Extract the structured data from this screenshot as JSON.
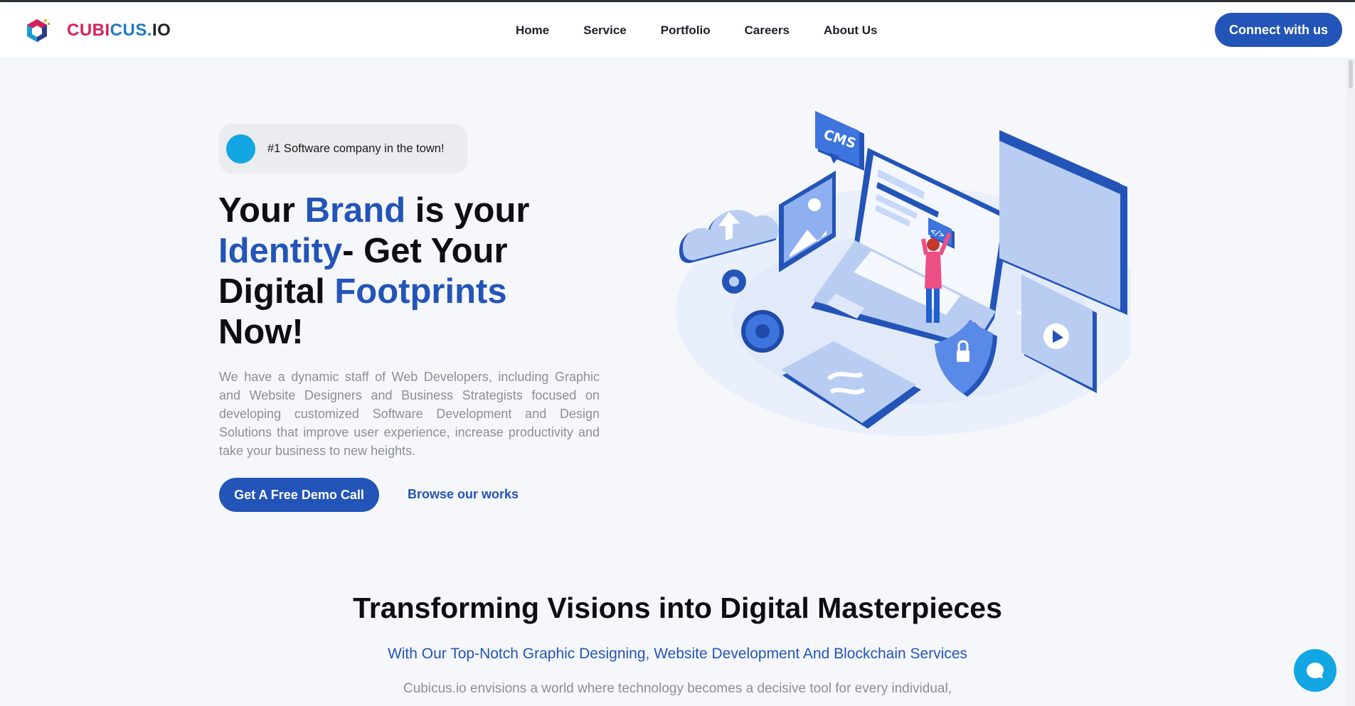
{
  "nav": {
    "logo": {
      "part1": "CUBI",
      "part2": "CUS.",
      "part3": "IO"
    },
    "links": [
      "Home",
      "Service",
      "Portfolio",
      "Careers",
      "About Us"
    ],
    "cta": "Connect with us"
  },
  "hero": {
    "badge": "#1 Software company in the town!",
    "title": {
      "w1": "Your ",
      "w2": "Brand",
      "w3": " is your ",
      "w4": "Identity",
      "w5": "- Get Your Digital ",
      "w6": "Footprints",
      "w7": " Now!"
    },
    "description": "We have a dynamic staff of Web Developers, including Graphic and Website Designers and Business Strategists focused on developing customized Software Development and Design Solutions that improve user experience, increase productivity and take your business to new heights.",
    "primary_button": "Get A Free Demo Call",
    "secondary_link": "Browse our works",
    "illustration": {
      "cms_label": "CMS",
      "code_label": "</>"
    }
  },
  "section": {
    "title": "Transforming Visions into Digital Masterpieces",
    "subtitle": "With Our Top-Notch Graphic Designing, Website Development And Blockchain Services",
    "text": "Cubicus.io envisions a world where technology becomes a decisive tool for every individual,"
  },
  "colors": {
    "brand_blue": "#2354b8",
    "accent_cyan": "#12a6e3",
    "background": "#f6f7fa"
  },
  "icons": [
    "cubicus-logo-icon",
    "chat-icon"
  ]
}
